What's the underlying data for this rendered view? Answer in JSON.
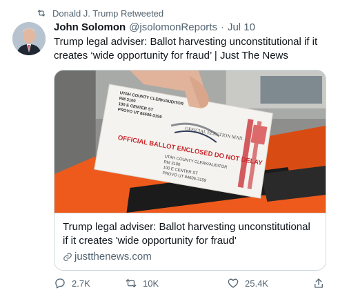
{
  "retweet_banner": {
    "text": "Donald J. Trump Retweeted"
  },
  "tweet": {
    "author_name": "John Solomon",
    "handle": "@jsolomonReports",
    "separator": "·",
    "date": "Jul 10",
    "text": "Trump legal adviser: Ballot harvesting unconstitutional if it creates ‘wide opportunity for fraud’ | Just The News"
  },
  "card": {
    "title": "Trump legal adviser: Ballot harvesting unconstitutional if it creates 'wide opportunity for fraud'",
    "domain": "justthenews.com",
    "image": {
      "envelope_return_address": [
        "UTAH COUNTY CLERK/AUDITOR",
        "RM 3100",
        "100 E CENTER ST",
        "PROVO UT 84606-3159"
      ],
      "envelope_banner": "OFFICIAL BALLOT ENCLOSED DO NOT DELAY",
      "envelope_seal_text": "OFFICIAL ELECTION MAIL",
      "envelope_address_bottom": [
        "UTAH COUNTY CLERK/AUDITOR",
        "RM 3100",
        "100 E CENTER ST",
        "PROVO UT 84606-3159"
      ]
    }
  },
  "actions": {
    "replies": "2.7K",
    "retweets": "10K",
    "likes": "25.4K"
  },
  "colors": {
    "secondary_text": "#536471",
    "border": "#cfd9de",
    "ballot_red": "#c8282d",
    "orange_vest": "#ee5a1c"
  }
}
